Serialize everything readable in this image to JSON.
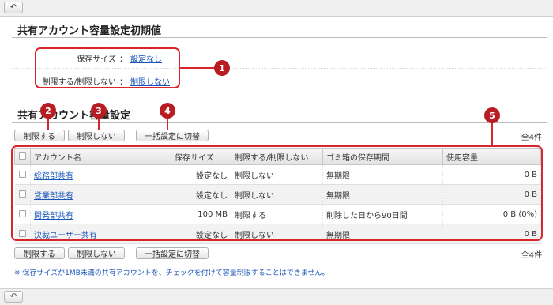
{
  "nav": {
    "back_symbol": "↶"
  },
  "defaults": {
    "title": "共有アカウント容量設定初期値",
    "rows": [
      {
        "label": "保存サイズ",
        "sep": "：",
        "value": "設定なし"
      },
      {
        "label": "制限する/制限しない",
        "sep": "：",
        "value": "制限しない"
      }
    ]
  },
  "settings": {
    "title": "共有アカウント容量設定",
    "buttons": {
      "limit": "制限する",
      "no_limit": "制限しない",
      "bulk": "一括設定に切替"
    },
    "count": "全4件",
    "columns": [
      "アカウント名",
      "保存サイズ",
      "制限する/制限しない",
      "ゴミ箱の保存期間",
      "使用容量"
    ],
    "rows": [
      {
        "name": "総務部共有",
        "size": "設定なし",
        "limit": "制限しない",
        "trash": "無期限",
        "usage": "0 B"
      },
      {
        "name": "営業部共有",
        "size": "設定なし",
        "limit": "制限しない",
        "trash": "無期限",
        "usage": "0 B"
      },
      {
        "name": "開発部共有",
        "size": "100 MB",
        "limit": "制限する",
        "trash": "削除した日から90日間",
        "usage": "0 B (0%)"
      },
      {
        "name": "決裁ユーザー共有",
        "size": "設定なし",
        "limit": "制限しない",
        "trash": "無期限",
        "usage": "0 B"
      }
    ],
    "note": "※ 保存サイズが1MB未満の共有アカウントを、チェックを付けて容量制限することはできません。"
  },
  "callouts": [
    "1",
    "2",
    "3",
    "4",
    "5"
  ],
  "colors": {
    "callout": "#d7272d",
    "badge": "#b81d24",
    "link": "#1a56b8"
  }
}
